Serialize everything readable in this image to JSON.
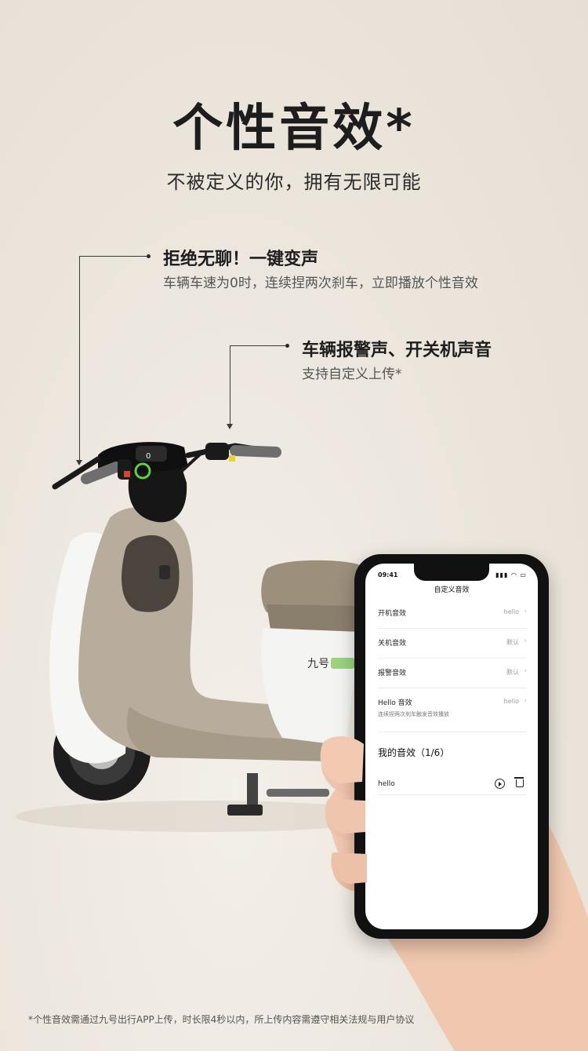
{
  "header": {
    "title": "个性音效*",
    "subtitle": "不被定义的你，拥有无限可能"
  },
  "callouts": [
    {
      "title": "拒绝无聊！一键变声",
      "desc": "车辆车速为0时，连续捏两次刹车，立即播放个性音效"
    },
    {
      "title": "车辆报警声、开关机声音",
      "desc": "支持自定义上传*"
    }
  ],
  "scooter": {
    "brand_badge": "九号"
  },
  "phone": {
    "time": "09:41",
    "status_icons": "▮▮▮ ◠ ▭",
    "screen_title": "自定义音效",
    "rows": [
      {
        "label": "开机音效",
        "value": "hello",
        "sub": ""
      },
      {
        "label": "关机音效",
        "value": "默认",
        "sub": ""
      },
      {
        "label": "报警音效",
        "value": "默认",
        "sub": ""
      },
      {
        "label": "Hello 音效",
        "value": "hello",
        "sub": "连续捏两次刹车触发音效播放"
      }
    ],
    "chevron": "›",
    "my_sounds_title": "我的音效（1/6）",
    "my_sounds": [
      {
        "label": "hello"
      }
    ]
  },
  "footnote": "*个性音效需通过九号出行APP上传，时长限4秒以内，所上传内容需遵守相关法规与用户协议"
}
